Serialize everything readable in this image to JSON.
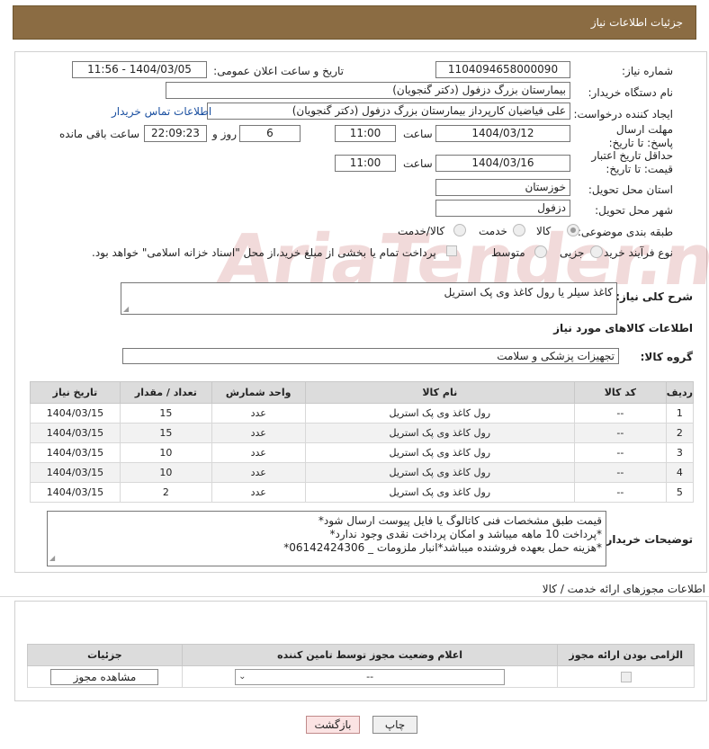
{
  "header": {
    "title": "جزئیات اطلاعات نیاز"
  },
  "form": {
    "need_number_label": "شماره نیاز:",
    "need_number": "1104094658000090",
    "announce_label": "تاریخ و ساعت اعلان عمومی:",
    "announce_value": "1404/03/05 - 11:56",
    "buyer_org_label": "نام دستگاه خریدار:",
    "buyer_org": "بیمارستان بزرگ دزفول (دکتر گنجویان)",
    "creator_label": "ایجاد کننده درخواست:",
    "creator": "علی فیاضیان کارپرداز بیمارستان بزرگ دزفول (دکتر گنجویان)",
    "contact_link": "اطلاعات تماس خریدار",
    "deadline_label": "مهلت ارسال پاسخ: تا تاریخ:",
    "deadline_date": "1404/03/12",
    "time_label": "ساعت",
    "deadline_time": "11:00",
    "days_value": "6",
    "days_label": "روز و",
    "remaining_time": "22:09:23",
    "remaining_label": "ساعت باقی مانده",
    "validity_label": "حداقل تاریخ اعتبار قیمت: تا تاریخ:",
    "validity_date": "1404/03/16",
    "validity_time": "11:00",
    "province_label": "استان محل تحویل:",
    "province": "خوزستان",
    "city_label": "شهر محل تحویل:",
    "city": "دزفول",
    "category_label": "طبقه بندی موضوعی:",
    "category_options": [
      "کالا",
      "خدمت",
      "کالا/خدمت"
    ],
    "process_label": "نوع فرآیند خرید :",
    "process_options": [
      "جزیی",
      "متوسط"
    ],
    "payment_note": "پرداخت تمام یا بخشی از مبلغ خرید،از محل \"اسناد خزانه اسلامی\" خواهد بود.",
    "summary_label": "شرح کلی نیاز:",
    "summary": "کاغذ سیلر یا رول کاغذ وی پک استریل",
    "goods_info_title": "اطلاعات کالاهای مورد نیاز",
    "goods_group_label": "گروه کالا:",
    "goods_group": "تجهیزات پزشکی و سلامت"
  },
  "items_table": {
    "headers": [
      "ردیف",
      "کد کالا",
      "نام کالا",
      "واحد شمارش",
      "تعداد / مقدار",
      "تاریخ نیاز"
    ],
    "rows": [
      [
        "1",
        "--",
        "رول کاغذ وی پک استریل",
        "عدد",
        "15",
        "1404/03/15"
      ],
      [
        "2",
        "--",
        "رول کاغذ وی پک استریل",
        "عدد",
        "15",
        "1404/03/15"
      ],
      [
        "3",
        "--",
        "رول کاغذ وی پک استریل",
        "عدد",
        "10",
        "1404/03/15"
      ],
      [
        "4",
        "--",
        "رول کاغذ وی پک استریل",
        "عدد",
        "10",
        "1404/03/15"
      ],
      [
        "5",
        "--",
        "رول کاغذ وی پک استریل",
        "عدد",
        "2",
        "1404/03/15"
      ]
    ]
  },
  "buyer_notes": {
    "label": "توضیحات خریدار:",
    "lines": [
      "قیمت طبق مشخصات فنی کاتالوگ یا فایل پیوست ارسال شود*",
      "*پرداخت 10 ماهه میباشد و امکان پرداخت نقدی وجود ندارد*",
      "*هزینه حمل بعهده فروشنده میباشد*انبار ملزومات _ 06142424306*"
    ]
  },
  "license": {
    "title": "اطلاعات مجوزهای ارائه خدمت / کالا",
    "headers": [
      "الزامی بودن ارائه مجوز",
      "اعلام وضعیت مجوز توسط تامین کننده",
      "جزئیات"
    ],
    "select_value": "--",
    "view_button": "مشاهده مجوز"
  },
  "buttons": {
    "print": "چاپ",
    "back": "بازگشت"
  },
  "watermark": "AriaTender.net"
}
